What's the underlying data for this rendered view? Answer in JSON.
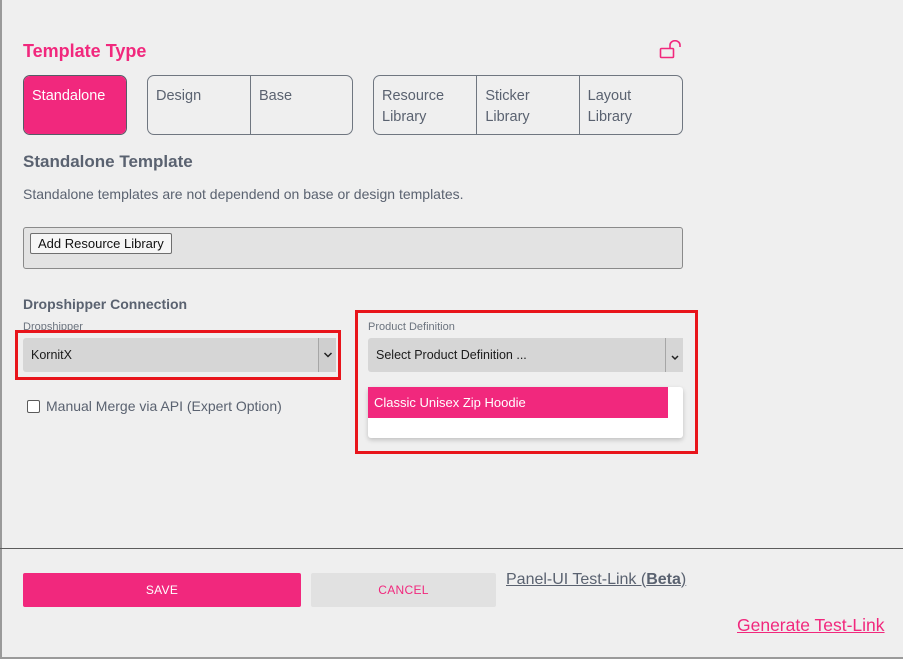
{
  "template_type": {
    "title": "Template Type",
    "lock_icon": "unlocked-padlock-icon",
    "options": [
      {
        "label": "Standalone",
        "active": true
      },
      {
        "label": "Design",
        "active": false
      },
      {
        "label": "Base",
        "active": false
      },
      {
        "label": "Resource Library",
        "active": false
      },
      {
        "label": "Sticker Library",
        "active": false
      },
      {
        "label": "Layout Library",
        "active": false
      }
    ]
  },
  "standalone": {
    "title": "Standalone Template",
    "description": "Standalone templates are not dependend on base or design templates.",
    "add_resource_label": "Add Resource Library"
  },
  "dropshipper_connection": {
    "title": "Dropshipper Connection",
    "dropshipper_label": "Dropshipper",
    "dropshipper_value": "KornitX",
    "product_definition_label": "Product Definition",
    "product_definition_value": "Select Product Definition ...",
    "dropdown_options": [
      "Classic Unisex Zip Hoodie"
    ],
    "manual_merge_label": "Manual Merge via API (Expert Option)",
    "manual_merge_checked": false
  },
  "footer": {
    "save_label": "SAVE",
    "cancel_label": "CANCEL",
    "panel_link_prefix": "Panel-UI Test-Link (",
    "panel_link_beta": "Beta",
    "panel_link_suffix": ")",
    "generate_link_label": "Generate Test-Link"
  },
  "colors": {
    "accent": "#f1287d",
    "highlight_border": "#e8141b",
    "text": "#5a6270",
    "background": "#efefef"
  }
}
